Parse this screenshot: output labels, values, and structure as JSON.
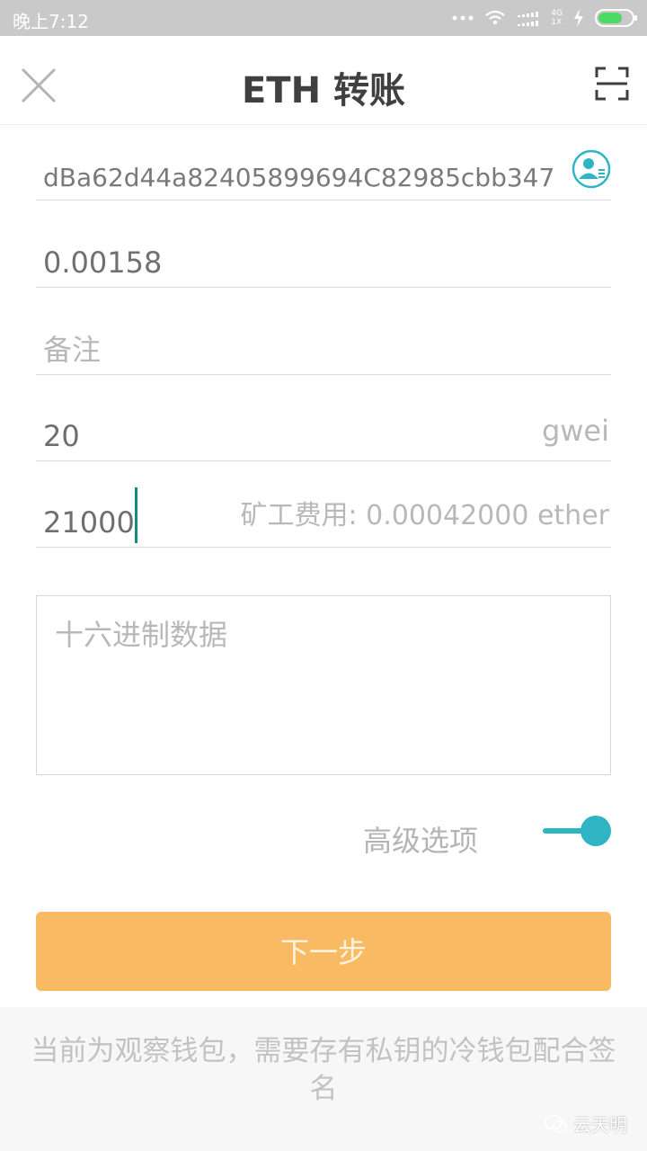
{
  "status_bar": {
    "time": "晚上7:12",
    "network_top": "4G",
    "network_bottom": "1X"
  },
  "header": {
    "title": "ETH 转账",
    "close_icon": "close-icon",
    "scan_icon": "scan-icon"
  },
  "form": {
    "address_value": "dBa62d44a82405899694C82985cbb347",
    "amount_value": "0.00158",
    "memo_placeholder": "备注",
    "gas_price_value": "20",
    "gas_price_unit": "gwei",
    "gas_limit_value": "21000",
    "fee_text": "矿工费用: 0.00042000 ether",
    "hex_placeholder": "十六进制数据",
    "advanced_label": "高级选项",
    "advanced_enabled": true
  },
  "actions": {
    "next_label": "下一步"
  },
  "notice": {
    "text": "当前为观察钱包，需要存有私钥的冷钱包配合签名"
  },
  "watermark": {
    "text": "云天明"
  },
  "colors": {
    "accent": "#2fb4c4",
    "button": "#f8ba63",
    "caret": "#0e8f86"
  }
}
